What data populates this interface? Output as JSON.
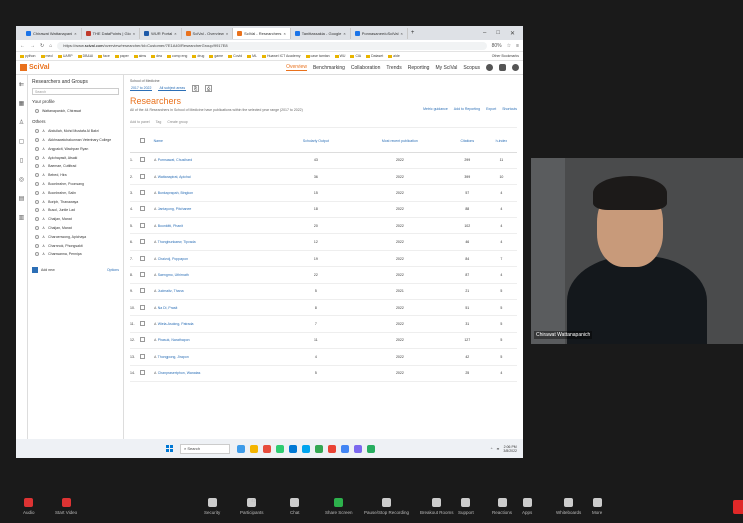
{
  "browser": {
    "tabs": [
      {
        "label": "Chirawat Wattanapani",
        "color": "#1a73e8",
        "active": false
      },
      {
        "label": "THE DataPoints | Glo",
        "color": "#c0392b",
        "active": false
      },
      {
        "label": "WUR Portal",
        "color": "#1e5aa8",
        "active": false
      },
      {
        "label": "SciVal - Overview",
        "color": "#e9711c",
        "active": false
      },
      {
        "label": "SciVal - Researchers",
        "color": "#e9711c",
        "active": true
      },
      {
        "label": "Tanittassakia - Google",
        "color": "#1a73e8",
        "active": false
      },
      {
        "label": "Ponnasanee/uSciVal",
        "color": "#1a73e8",
        "active": false
      }
    ],
    "url_prefix": "https://www.",
    "url_domain": "scival.com",
    "url_rest": "/overview/researcher/id=Customer/7E1A40/ResearcherGroup/9917E8",
    "zoom": "80%",
    "bookmarks": [
      "python",
      "mecl",
      "UARP",
      "DB&AI",
      "face",
      "paper",
      "aims",
      "dea",
      "comp eng",
      "drug",
      "game",
      "Covid",
      "ML",
      "Huawei ICT Academy",
      "case tamtan",
      "WU",
      "ClA",
      "Dataset",
      "aide"
    ],
    "other_bookmarks": "Other Bookmarks"
  },
  "scival": {
    "logo": "SciVal",
    "nav": [
      "Overview",
      "Benchmarking",
      "Collaboration",
      "Trends",
      "Reporting",
      "My SciVal",
      "Scopus"
    ],
    "active_nav": "Overview"
  },
  "left_panel": {
    "title": "Researchers and Groups",
    "search_placeholder": "Search",
    "your_profile_heading": "Your profile",
    "your_profile_name": "Wattanapanich, Chirawat",
    "others_heading": "Others",
    "others": [
      "Abdullah, Mohd Mustafa Al Bakri",
      "Akkhrawatchakunnan Veterinary College",
      "Angpaicit, Wachpan Ryan",
      "Apichayasit, Atsaki",
      "Baemae, Cuttitrad",
      "Bebed, Hira",
      "Boonbrahm, Poonsang",
      "Boonbrahm, Salin",
      "Boriph, Thanawaya",
      "Busol, Juntle Lad",
      "Chaijan, Manat",
      "Chaijan, Manat",
      "Charoenwong, Apichaya",
      "Charnnok, Phongsakit",
      "Chanwanna, Pennipa"
    ],
    "add_new": "Add new",
    "options": "Options"
  },
  "content": {
    "entity_label": "School of Medicine",
    "year_range": "2017 to 2022",
    "subject_area": "All subject areas",
    "title": "Researchers",
    "metric_guidance": "Metric guidance",
    "add_to_reporting": "Add to Reporting",
    "export": "Export",
    "shortcuts": "Shortcuts",
    "description": "All of the 44 Researchers in School of Medicine have publications within the selected year range (2017 to 2022)",
    "toolbar": [
      "Add to panel",
      "Tag",
      "Create group"
    ],
    "col_name": "Name",
    "col_output": "Scholarly Output",
    "col_recent": "Most recent publication",
    "col_citations": "Citations",
    "col_hindex": "h-index",
    "rows": [
      {
        "idx": "1.",
        "name": "Pornsawat, Chusihard",
        "output": "43",
        "recent": "2022",
        "citations": "299",
        "h": "11"
      },
      {
        "idx": "2.",
        "name": "Wattanapirat, Apichai",
        "output": "36",
        "recent": "2022",
        "citations": "399",
        "h": "10"
      },
      {
        "idx": "3.",
        "name": "Bunkaprapah, Bingkon",
        "output": "15",
        "recent": "2022",
        "citations": "57",
        "h": "4"
      },
      {
        "idx": "4.",
        "name": "Jantayong, Pitchanee",
        "output": "18",
        "recent": "2022",
        "citations": "88",
        "h": "4"
      },
      {
        "idx": "5.",
        "name": "Boonkitti, Phanit",
        "output": "20",
        "recent": "2022",
        "citations": "102",
        "h": "4"
      },
      {
        "idx": "6.",
        "name": "Thongbunkaew, Tipvada",
        "output": "12",
        "recent": "2022",
        "citations": "46",
        "h": "4"
      },
      {
        "idx": "7.",
        "name": "Chaivoij, Poppapon",
        "output": "19",
        "recent": "2022",
        "citations": "84",
        "h": "7"
      },
      {
        "idx": "8.",
        "name": "Saengmo, Uthirnath",
        "output": "22",
        "recent": "2022",
        "citations": "87",
        "h": "4"
      },
      {
        "idx": "9.",
        "name": "Judmaitz, Thana",
        "output": "5",
        "recent": "2021",
        "citations": "21",
        "h": "5"
      },
      {
        "idx": "10.",
        "name": "Na Di, Prasit",
        "output": "8",
        "recent": "2022",
        "citations": "51",
        "h": "5"
      },
      {
        "idx": "11.",
        "name": "Wiela-Asokng, Patrada",
        "output": "7",
        "recent": "2022",
        "citations": "31",
        "h": "5"
      },
      {
        "idx": "12.",
        "name": "Phasuk, Narathapon",
        "output": "11",
        "recent": "2022",
        "citations": "127",
        "h": "5"
      },
      {
        "idx": "13.",
        "name": "Thongpong, Jirapon",
        "output": "4",
        "recent": "2022",
        "citations": "42",
        "h": "5"
      },
      {
        "idx": "14.",
        "name": "Chanprasertphon, Wanatas",
        "output": "5",
        "recent": "2022",
        "citations": "25",
        "h": "4"
      }
    ]
  },
  "taskbar": {
    "search": "Search",
    "time": "2:06 PM",
    "date": "3/8/2022",
    "apps": [
      "#3d9be9",
      "#f4b400",
      "#e74c3c",
      "#2ecc71",
      "#0078d4",
      "#00a4ef",
      "#34a853",
      "#ea4335",
      "#4285f4",
      "#7b68ee",
      "#27ae60"
    ]
  },
  "video": {
    "participant": "Chirawat Wattanapanich"
  },
  "zoom_controls": [
    {
      "label": "Audio",
      "icon": "microphone-icon",
      "color": "red"
    },
    {
      "label": "Start Video",
      "icon": "video-off-icon",
      "color": "red"
    },
    {
      "label": "Security",
      "icon": "shield-icon",
      "color": "grey"
    },
    {
      "label": "Participants",
      "icon": "participants-icon",
      "color": "grey",
      "count": "42"
    },
    {
      "label": "Chat",
      "icon": "chat-icon",
      "color": "grey"
    },
    {
      "label": "Share Screen",
      "icon": "share-screen-icon",
      "color": "green"
    },
    {
      "label": "Pause/Stop Recording",
      "icon": "recording-icon",
      "color": "grey"
    },
    {
      "label": "Breakout Rooms",
      "icon": "breakout-rooms-icon",
      "color": "grey"
    },
    {
      "label": "Support",
      "icon": "support-icon",
      "color": "grey"
    },
    {
      "label": "Reactions",
      "icon": "reactions-icon",
      "color": "grey"
    },
    {
      "label": "Apps",
      "icon": "apps-icon",
      "color": "grey"
    },
    {
      "label": "Whiteboards",
      "icon": "whiteboard-icon",
      "color": "grey"
    },
    {
      "label": "More",
      "icon": "more-icon",
      "color": "grey"
    }
  ]
}
